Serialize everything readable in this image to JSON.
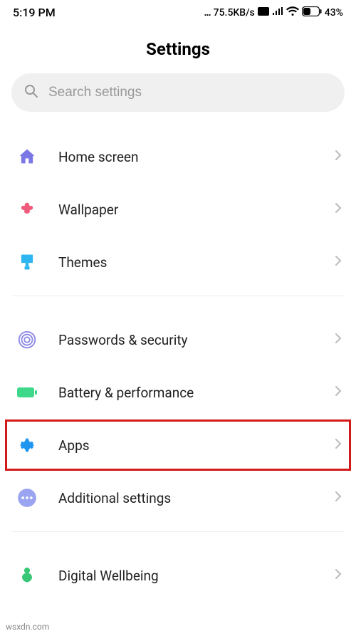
{
  "status_bar": {
    "time": "5:19 PM",
    "net_speed": "75.5KB/s",
    "battery_pct": "43%"
  },
  "page": {
    "title": "Settings"
  },
  "search": {
    "placeholder": "Search settings"
  },
  "groups": [
    {
      "items": [
        {
          "id": "home-screen",
          "label": "Home screen",
          "icon": "home-icon",
          "color": "#7b78e6"
        },
        {
          "id": "wallpaper",
          "label": "Wallpaper",
          "icon": "flower-icon",
          "color": "#ef5b7a"
        },
        {
          "id": "themes",
          "label": "Themes",
          "icon": "brush-icon",
          "color": "#2fb5f0"
        }
      ]
    },
    {
      "items": [
        {
          "id": "passwords-security",
          "label": "Passwords & security",
          "icon": "fingerprint-icon",
          "color": "#8e8ae6"
        },
        {
          "id": "battery-performance",
          "label": "Battery & performance",
          "icon": "battery-icon",
          "color": "#3fd88a"
        },
        {
          "id": "apps",
          "label": "Apps",
          "icon": "gear-icon",
          "color": "#1e96f0",
          "highlight": true
        },
        {
          "id": "additional-settings",
          "label": "Additional settings",
          "icon": "dots-icon",
          "color": "#9aa4f0"
        }
      ]
    },
    {
      "items": [
        {
          "id": "digital-wellbeing",
          "label": "Digital Wellbeing",
          "icon": "wellbeing-icon",
          "color": "#37c776"
        }
      ]
    }
  ],
  "watermark": "wsxdn.com"
}
